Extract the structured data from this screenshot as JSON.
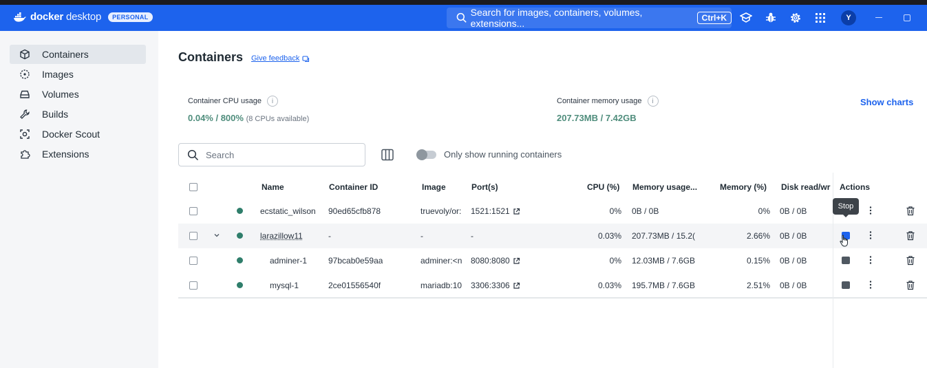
{
  "app": {
    "brand_bold": "docker",
    "brand_light": " desktop",
    "plan": "PERSONAL",
    "global_search_placeholder": "Search for images, containers, volumes, extensions...",
    "shortcut": "Ctrl+K",
    "user_initial": "Y",
    "accent_color": "#1d63ed"
  },
  "sidebar": {
    "items": [
      {
        "label": "Containers",
        "icon": "container-cube-icon",
        "active": true
      },
      {
        "label": "Images",
        "icon": "images-icon"
      },
      {
        "label": "Volumes",
        "icon": "volumes-disk-icon"
      },
      {
        "label": "Builds",
        "icon": "builds-wrench-icon"
      },
      {
        "label": "Docker Scout",
        "icon": "scout-icon"
      },
      {
        "label": "Extensions",
        "icon": "extensions-puzzle-icon"
      }
    ]
  },
  "main": {
    "title": "Containers",
    "feedback": "Give feedback",
    "cpu": {
      "label": "Container CPU usage",
      "value": "0.04% / 800%",
      "note": "(8 CPUs available)"
    },
    "memory": {
      "label": "Container memory usage",
      "value": "207.73MB / 7.42GB"
    },
    "show_charts": "Show charts",
    "search_placeholder": "Search",
    "running_toggle_label": "Only show running containers",
    "tooltip": "Stop"
  },
  "table": {
    "headers": {
      "name": "Name",
      "container_id": "Container ID",
      "image": "Image",
      "ports": "Port(s)",
      "cpu": "CPU (%)",
      "mem_usage": "Memory usage...",
      "mem_pct": "Memory (%)",
      "disk": "Disk read/wr",
      "actions": "Actions"
    },
    "rows": [
      {
        "name": "ecstatic_wilson",
        "id": "90ed65cfb878",
        "image": "truevoly/or:",
        "port": "1521:1521",
        "cpu": "0%",
        "mem": "0B / 0B",
        "mem_pct": "0%",
        "disk": "0B / 0B"
      },
      {
        "name": "larazillow11",
        "id": "-",
        "image": "-",
        "port": "-",
        "cpu": "0.03%",
        "mem": "207.73MB / 15.2(",
        "mem_pct": "2.66%",
        "disk": "0B / 0B"
      },
      {
        "name": "adminer-1",
        "id": "97bcab0e59aa",
        "image": "adminer:<n",
        "port": "8080:8080",
        "cpu": "0%",
        "mem": "12.03MB / 7.6GB",
        "mem_pct": "0.15%",
        "disk": "0B / 0B"
      },
      {
        "name": "mysql-1",
        "id": "2ce01556540f",
        "image": "mariadb:10",
        "port": "3306:3306",
        "cpu": "0.03%",
        "mem": "195.7MB / 7.6GB",
        "mem_pct": "2.51%",
        "disk": "0B / 0B"
      }
    ]
  }
}
